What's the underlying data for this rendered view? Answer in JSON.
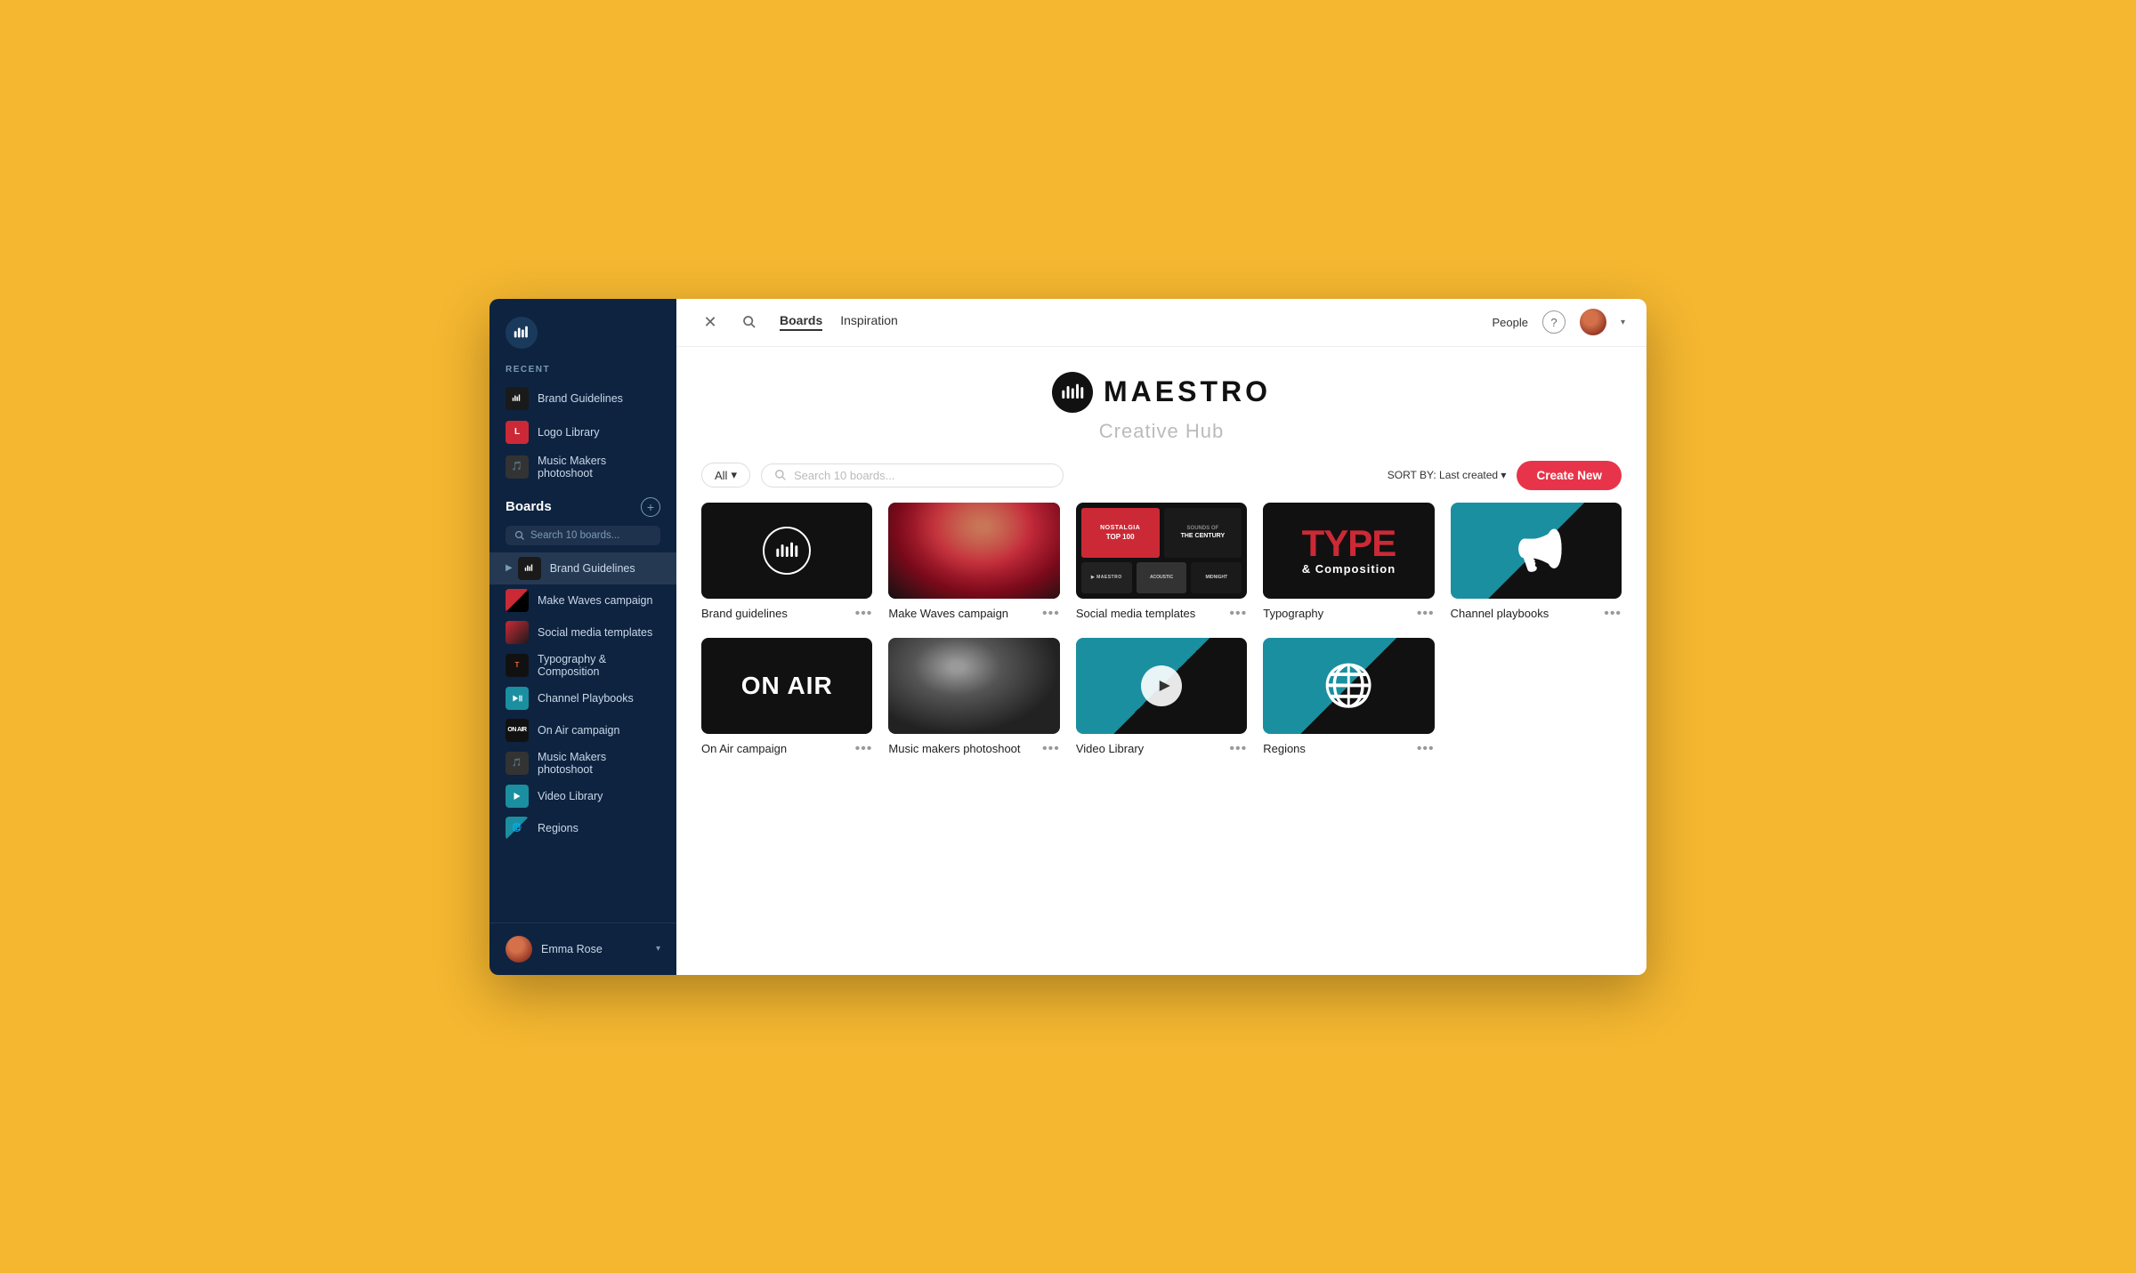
{
  "app": {
    "title": "Maestro Creative Hub"
  },
  "sidebar": {
    "recent_label": "RECENT",
    "recent_items": [
      {
        "id": "brand-guidelines",
        "label": "Brand Guidelines",
        "thumb_type": "brand"
      },
      {
        "id": "logo-library",
        "label": "Logo Library",
        "thumb_type": "logo"
      },
      {
        "id": "music-makers-recent",
        "label": "Music Makers photoshoot",
        "thumb_type": "music"
      }
    ],
    "boards_label": "Boards",
    "boards_add_title": "+",
    "search_placeholder": "Search 10 boards...",
    "nav_items": [
      {
        "id": "brand-guidelines-nav",
        "label": "Brand Guidelines",
        "thumb_type": "brand",
        "active": true,
        "chevron": true
      },
      {
        "id": "make-waves-nav",
        "label": "Make Waves campaign",
        "thumb_type": "waves"
      },
      {
        "id": "social-media-nav",
        "label": "Social media templates",
        "thumb_type": "social"
      },
      {
        "id": "typography-nav",
        "label": "Typography & Composition",
        "thumb_type": "type"
      },
      {
        "id": "channel-nav",
        "label": "Channel Playbooks",
        "thumb_type": "channel"
      },
      {
        "id": "onair-nav",
        "label": "On Air campaign",
        "thumb_type": "onair"
      },
      {
        "id": "music-makers-nav",
        "label": "Music Makers photoshoot",
        "thumb_type": "music"
      },
      {
        "id": "video-nav",
        "label": "Video Library",
        "thumb_type": "video"
      },
      {
        "id": "regions-nav",
        "label": "Regions",
        "thumb_type": "regions"
      }
    ],
    "footer": {
      "user_name": "Emma Rose",
      "chevron": "▾"
    }
  },
  "topbar": {
    "close_icon": "✕",
    "search_icon": "🔍",
    "nav_items": [
      {
        "id": "boards-tab",
        "label": "Boards",
        "active": true
      },
      {
        "id": "inspiration-tab",
        "label": "Inspiration",
        "active": false
      }
    ],
    "right": {
      "people_label": "People",
      "help_label": "?",
      "avatar_chevron": "▾"
    }
  },
  "hub": {
    "logo_text": "MAESTRO",
    "subtitle": "Creative Hub"
  },
  "filter_bar": {
    "all_label": "All",
    "all_chevron": "▾",
    "search_placeholder": "Search 10 boards...",
    "sort_prefix": "SORT BY:",
    "sort_value": "Last created",
    "sort_chevron": "▾",
    "create_label": "Create New"
  },
  "boards": {
    "row1": [
      {
        "id": "brand-guidelines",
        "label": "Brand guidelines",
        "thumb": "brand"
      },
      {
        "id": "make-waves",
        "label": "Make Waves campaign",
        "thumb": "waves"
      },
      {
        "id": "social-media",
        "label": "Social media templates",
        "thumb": "social"
      },
      {
        "id": "typography",
        "label": "Typography",
        "thumb": "type"
      },
      {
        "id": "channel-playbooks",
        "label": "Channel playbooks",
        "thumb": "channel"
      }
    ],
    "row2": [
      {
        "id": "on-air",
        "label": "On Air campaign",
        "thumb": "onair"
      },
      {
        "id": "music-makers",
        "label": "Music makers photoshoot",
        "thumb": "music"
      },
      {
        "id": "video-library",
        "label": "Video Library",
        "thumb": "video"
      },
      {
        "id": "regions",
        "label": "Regions",
        "thumb": "regions"
      }
    ]
  }
}
